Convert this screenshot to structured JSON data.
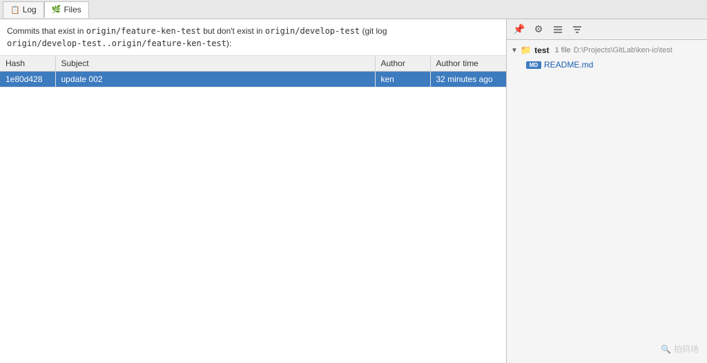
{
  "tabs": [
    {
      "id": "log",
      "label": "Log",
      "icon": "📋",
      "active": false
    },
    {
      "id": "files",
      "label": "Files",
      "icon": "🌿",
      "active": true
    }
  ],
  "description": {
    "line1": "Commits that exist in origin/feature-ken-test but don't exist in origin/develop-test (git log",
    "line2": "origin/develop-test..origin/feature-ken-test):"
  },
  "table": {
    "columns": [
      {
        "id": "hash",
        "label": "Hash"
      },
      {
        "id": "subject",
        "label": "Subject"
      },
      {
        "id": "author",
        "label": "Author"
      },
      {
        "id": "author_time",
        "label": "Author time"
      }
    ],
    "rows": [
      {
        "hash": "1e80d428",
        "subject": "update 002",
        "author": "ken",
        "author_time": "32 minutes ago",
        "selected": true
      }
    ]
  },
  "right_panel": {
    "toolbar": {
      "pin_label": "📌",
      "settings_label": "⚙",
      "sort_label": "≡",
      "filter_label": "≓"
    },
    "tree": {
      "folder": {
        "name": "test",
        "meta": "1 file",
        "path": "D:\\Projects\\GitLab\\ken-io\\test",
        "expanded": true
      },
      "files": [
        {
          "type_badge": "MD",
          "name": "README.md"
        }
      ]
    }
  },
  "watermark": {
    "icon": "🔍",
    "text": "拍码场"
  }
}
